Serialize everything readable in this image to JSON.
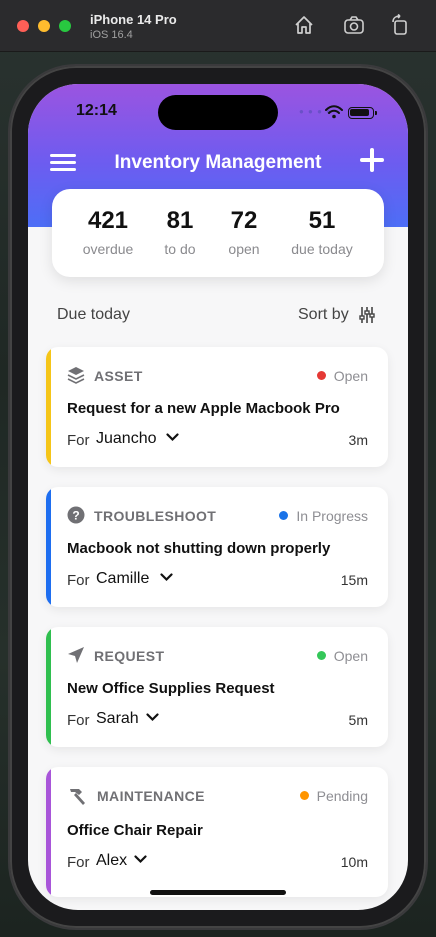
{
  "simulator": {
    "device_name": "iPhone 14 Pro",
    "os_version": "iOS 16.4",
    "icons": [
      "home-icon",
      "screenshot-icon",
      "rotate-icon"
    ]
  },
  "status_bar": {
    "time": "12:14",
    "icons": [
      "wifi-icon",
      "battery-icon"
    ]
  },
  "header": {
    "title": "Inventory Management",
    "menu_icon": "hamburger-menu-icon",
    "add_icon": "plus-icon"
  },
  "stats": [
    {
      "value": "421",
      "label": "overdue"
    },
    {
      "value": "81",
      "label": "to do"
    },
    {
      "value": "72",
      "label": "open"
    },
    {
      "value": "51",
      "label": "due today"
    }
  ],
  "list": {
    "section_title": "Due today",
    "sort_label": "Sort by",
    "sort_icon": "sliders-icon",
    "tickets": [
      {
        "category": "ASSET",
        "icon": "layers-icon",
        "status": "Open",
        "status_color": "#e53935",
        "accent": "#f5c518",
        "title": "Request for a new Apple Macbook Pro",
        "for_label": "For",
        "person": "Juancho",
        "age": "3m"
      },
      {
        "category": "TROUBLESHOOT",
        "icon": "question-circle-icon",
        "status": "In Progress",
        "status_color": "#1a73e8",
        "accent": "#1e6ef0",
        "title": "Macbook not shutting down properly",
        "for_label": "For",
        "person": "Camille",
        "age": "15m"
      },
      {
        "category": "REQUEST",
        "icon": "send-icon",
        "status": "Open",
        "status_color": "#34c759",
        "accent": "#2fbf4f",
        "title": "New Office Supplies Request",
        "for_label": "For",
        "person": "Sarah",
        "age": "5m"
      },
      {
        "category": "MAINTENANCE",
        "icon": "hammer-icon",
        "status": "Pending",
        "status_color": "#ff9500",
        "accent": "#a855d9",
        "title": "Office Chair Repair",
        "for_label": "For",
        "person": "Alex",
        "age": "10m"
      }
    ]
  },
  "colors": {
    "header_gradient_top": "#9b54e0",
    "header_gradient_bottom": "#4d6ef6"
  }
}
